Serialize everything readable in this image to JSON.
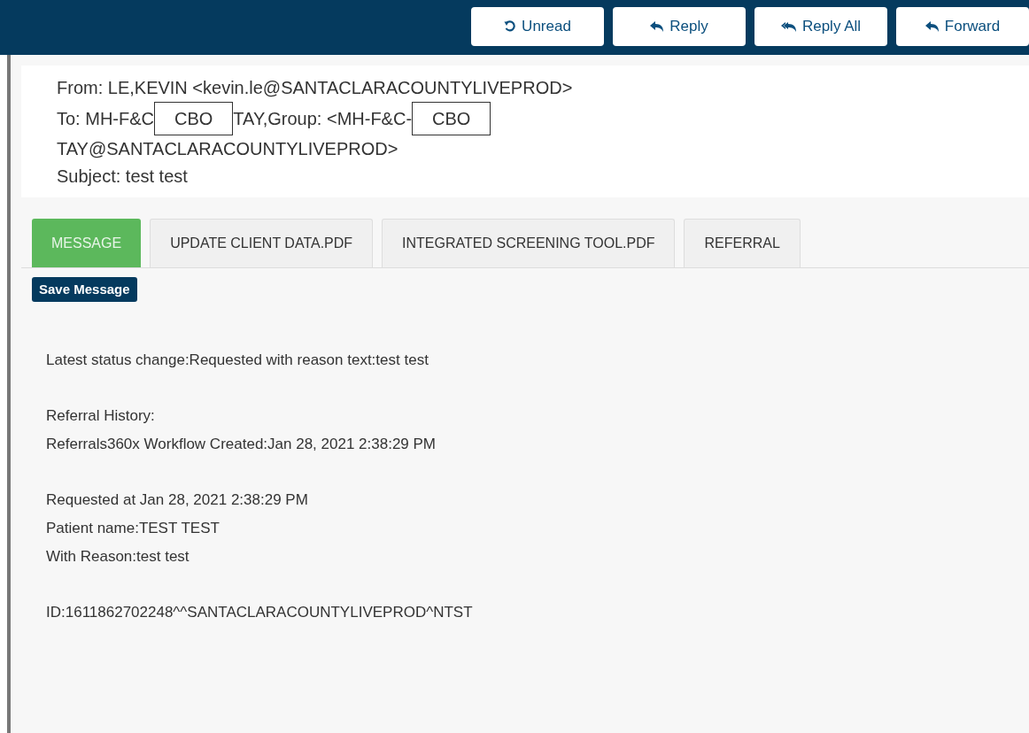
{
  "toolbar": {
    "buttons": [
      {
        "label": "Unread",
        "kind": "undo"
      },
      {
        "label": "Reply",
        "kind": "reply"
      },
      {
        "label": "Reply All",
        "kind": "reply-all"
      },
      {
        "label": "Forward",
        "kind": "forward"
      }
    ]
  },
  "header": {
    "from": "From: LE,KEVIN <kevin.le@SANTACLARACOUNTYLIVEPROD>",
    "to": [
      {
        "kind": "text",
        "text": "To: MH-F&C"
      },
      {
        "kind": "redaction",
        "text": "CBO"
      },
      {
        "kind": "text",
        "text": "TAY,Group: <MH-F&C-"
      },
      {
        "kind": "redaction",
        "text": "CBO"
      },
      {
        "kind": "break"
      },
      {
        "kind": "text",
        "text": "TAY@SANTACLARACOUNTYLIVEPROD>"
      }
    ],
    "subject": "Subject: test test"
  },
  "tabs": [
    {
      "label": "MESSAGE",
      "selected": true
    },
    {
      "label": "UPDATE CLIENT DATA.PDF",
      "selected": false
    },
    {
      "label": "INTEGRATED SCREENING TOOL.PDF",
      "selected": false
    },
    {
      "label": "REFERRAL",
      "selected": false
    }
  ],
  "save_button": "Save Message",
  "message": [
    [
      "Latest status change:Requested with reason text:test test"
    ],
    [
      "Referral History:",
      "Referrals360x Workflow Created:Jan 28, 2021 2:38:29 PM"
    ],
    [
      "Requested at Jan 28, 2021 2:38:29 PM",
      "Patient name:TEST TEST",
      "With Reason:test test"
    ],
    [
      "ID:1611862702248^^SANTACLARACOUNTYLIVEPROD^NTST"
    ]
  ]
}
